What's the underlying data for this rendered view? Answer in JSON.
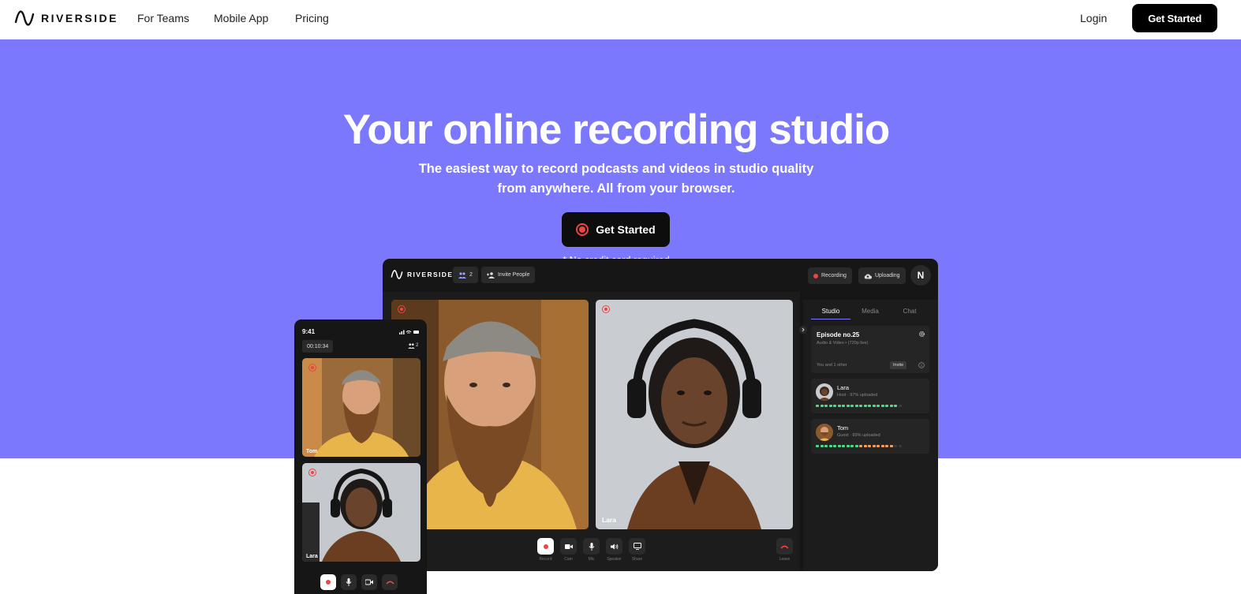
{
  "nav": {
    "brand": "RIVERSIDE",
    "links": [
      "For Teams",
      "Mobile App",
      "Pricing"
    ],
    "login": "Login",
    "cta": "Get Started"
  },
  "hero": {
    "title": "Your online recording studio",
    "subtitle_line1": "The easiest way to record podcasts and videos in studio quality",
    "subtitle_line2": "from anywhere. All from your browser.",
    "cta": "Get Started",
    "note": "* No credit card required",
    "bg_color": "#7b78fd"
  },
  "studio": {
    "brand": "RIVERSIDE",
    "participants_count": "2",
    "invite": "Invite People",
    "recording": "Recording",
    "uploading": "Uploading",
    "avatar_initial": "N",
    "tiles": [
      {
        "name": ""
      },
      {
        "name": "Lara"
      }
    ],
    "controls": [
      "Record",
      "Cam",
      "Mic",
      "Speaker",
      "Share"
    ],
    "leave": "Leave",
    "panel": {
      "tabs": [
        "Studio",
        "Media",
        "Chat"
      ],
      "episode_title": "Episode no.25",
      "episode_sub": "Audio & Video • (720p live)",
      "episode_foot": "You and 1 other",
      "episode_invite": "Invite",
      "participants": [
        {
          "name": "Lara",
          "status": "Host · 97% uploaded",
          "progress": 0.97
        },
        {
          "name": "Tom",
          "status": "Guest · 89% uploaded",
          "progress": 0.89
        }
      ]
    }
  },
  "phone": {
    "time": "9:41",
    "timer": "00:10:34",
    "count": "2",
    "tiles": [
      {
        "name": "Tom"
      },
      {
        "name": "Lara"
      }
    ]
  }
}
